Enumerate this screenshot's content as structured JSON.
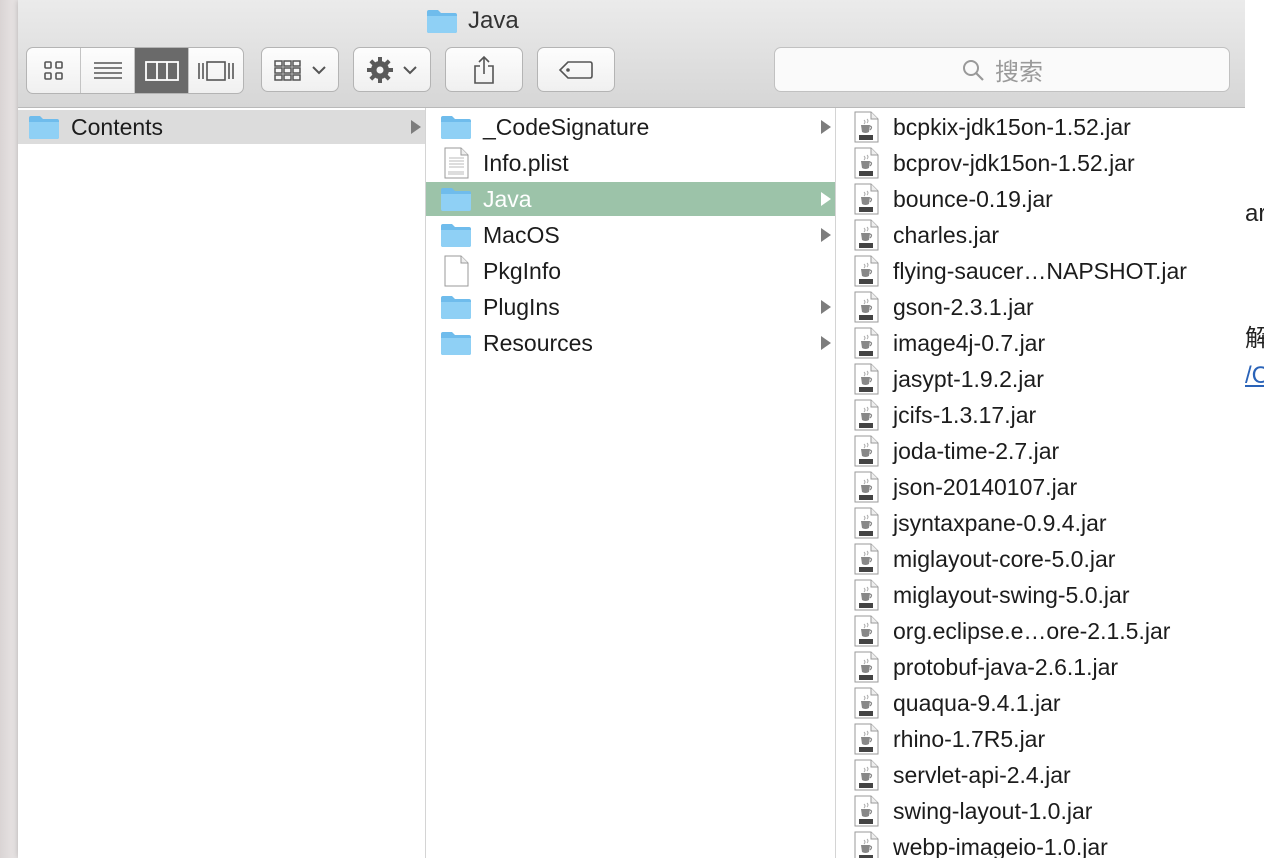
{
  "window": {
    "title": "Java"
  },
  "toolbar": {
    "view_modes": [
      {
        "name": "icon-view-icon",
        "active": false
      },
      {
        "name": "list-view-icon",
        "active": false
      },
      {
        "name": "column-view-icon",
        "active": true
      },
      {
        "name": "cover-flow-icon",
        "active": false
      }
    ],
    "arrange_icon": "grid-arrange-icon",
    "action_icon": "gear-icon",
    "share_icon": "share-icon",
    "tags_icon": "tag-icon",
    "search_placeholder": "搜索"
  },
  "columns": [
    {
      "items": [
        {
          "label": "Contents",
          "type": "folder",
          "has_children": true,
          "selected": "gray"
        }
      ]
    },
    {
      "items": [
        {
          "label": "_CodeSignature",
          "type": "folder",
          "has_children": true,
          "selected": ""
        },
        {
          "label": "Info.plist",
          "type": "plist",
          "has_children": false,
          "selected": ""
        },
        {
          "label": "Java",
          "type": "folder",
          "has_children": true,
          "selected": "green"
        },
        {
          "label": "MacOS",
          "type": "folder",
          "has_children": true,
          "selected": ""
        },
        {
          "label": "PkgInfo",
          "type": "file",
          "has_children": false,
          "selected": ""
        },
        {
          "label": "PlugIns",
          "type": "folder",
          "has_children": true,
          "selected": ""
        },
        {
          "label": "Resources",
          "type": "folder",
          "has_children": true,
          "selected": ""
        }
      ]
    },
    {
      "items": [
        {
          "label": "bcpkix-jdk15on-1.52.jar",
          "type": "jar"
        },
        {
          "label": "bcprov-jdk15on-1.52.jar",
          "type": "jar"
        },
        {
          "label": "bounce-0.19.jar",
          "type": "jar"
        },
        {
          "label": "charles.jar",
          "type": "jar"
        },
        {
          "label": "flying-saucer…NAPSHOT.jar",
          "type": "jar"
        },
        {
          "label": "gson-2.3.1.jar",
          "type": "jar"
        },
        {
          "label": "image4j-0.7.jar",
          "type": "jar"
        },
        {
          "label": "jasypt-1.9.2.jar",
          "type": "jar"
        },
        {
          "label": "jcifs-1.3.17.jar",
          "type": "jar"
        },
        {
          "label": "joda-time-2.7.jar",
          "type": "jar"
        },
        {
          "label": "json-20140107.jar",
          "type": "jar"
        },
        {
          "label": "jsyntaxpane-0.9.4.jar",
          "type": "jar"
        },
        {
          "label": "miglayout-core-5.0.jar",
          "type": "jar"
        },
        {
          "label": "miglayout-swing-5.0.jar",
          "type": "jar"
        },
        {
          "label": "org.eclipse.e…ore-2.1.5.jar",
          "type": "jar"
        },
        {
          "label": "protobuf-java-2.6.1.jar",
          "type": "jar"
        },
        {
          "label": "quaqua-9.4.1.jar",
          "type": "jar"
        },
        {
          "label": "rhino-1.7R5.jar",
          "type": "jar"
        },
        {
          "label": "servlet-api-2.4.jar",
          "type": "jar"
        },
        {
          "label": "swing-layout-1.0.jar",
          "type": "jar"
        },
        {
          "label": "webp-imageio-1.0.jar",
          "type": "jar"
        }
      ]
    }
  ],
  "background_fragments": [
    {
      "text": "ar",
      "color": "#222222"
    },
    {
      "text": "解",
      "color": "#222222"
    },
    {
      "text": "/C",
      "color": "#2a63b8"
    }
  ],
  "colors": {
    "selection_active": "#9cc3a9",
    "selection_inactive": "#dcdcdc",
    "folder_blue": "#7fc6f0"
  }
}
